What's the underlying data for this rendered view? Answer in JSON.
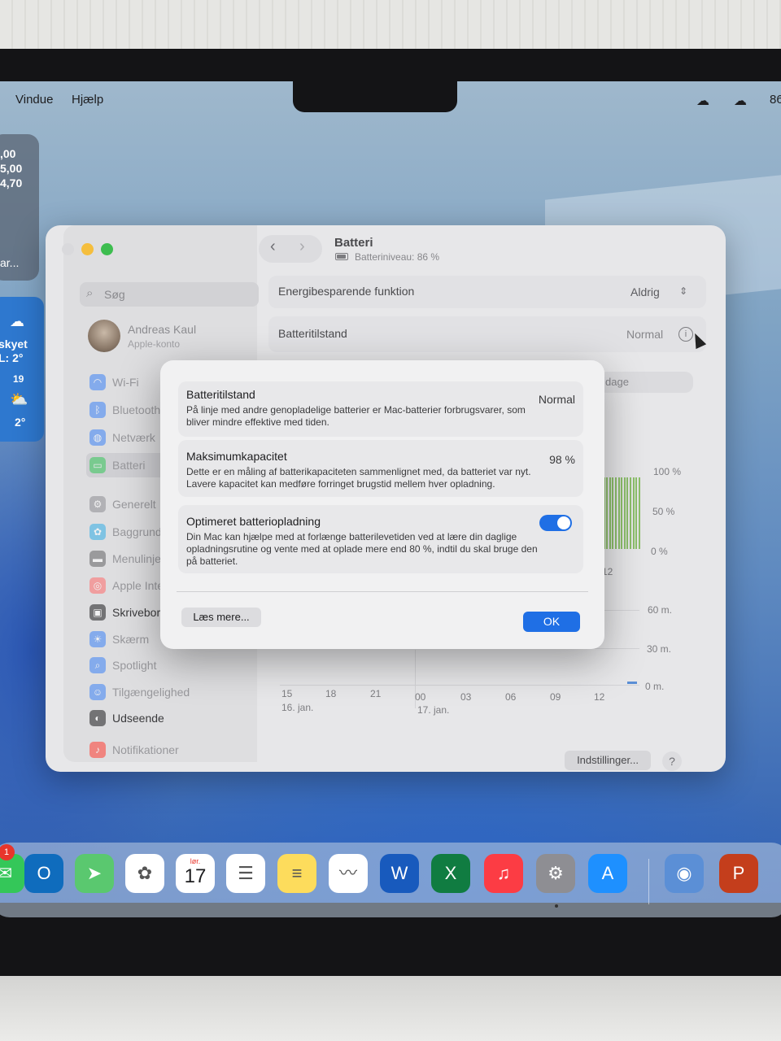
{
  "menubar": {
    "items": [
      "Vindue",
      "Hjælp"
    ],
    "right_text": "86"
  },
  "widgets": {
    "stocks_lines": [
      ",00",
      "5,00",
      "4,70",
      "ar..."
    ],
    "weather": {
      "condition": "skyet",
      "low": "L: 2°",
      "hour": "19",
      "temp": "2°"
    }
  },
  "window": {
    "title": "Batteri",
    "battery_level": "Batteriniveau: 86 %",
    "search_placeholder": "Søg",
    "account": {
      "name": "Andreas Kaul",
      "subtitle": "Apple-konto"
    },
    "sidebar_items": [
      {
        "label": "Wi-Fi",
        "icon": "wifi-icon",
        "color": "#3b82f6"
      },
      {
        "label": "Bluetooth",
        "icon": "bluetooth-icon",
        "color": "#3b82f6"
      },
      {
        "label": "Netværk",
        "icon": "globe-icon",
        "color": "#3b82f6"
      },
      {
        "label": "Batteri",
        "icon": "battery-icon",
        "color": "#34c759",
        "selected": true
      },
      {
        "label": "Generelt",
        "icon": "gear-icon",
        "color": "#8e8e93"
      },
      {
        "label": "Baggrund",
        "icon": "flower-icon",
        "color": "#32ade6"
      },
      {
        "label": "Menulinje",
        "icon": "menubar-icon",
        "color": "#636366"
      },
      {
        "label": "Apple Intellig",
        "icon": "apple-intelligence-icon",
        "color": "#ff6b6b"
      },
      {
        "label": "Skrivebord &",
        "icon": "desktop-icon",
        "color": "#1c1c1e"
      },
      {
        "label": "Skærm",
        "icon": "sun-icon",
        "color": "#3b82f6"
      },
      {
        "label": "Spotlight",
        "icon": "spotlight-icon",
        "color": "#3b82f6"
      },
      {
        "label": "Tilgængelighed",
        "icon": "accessibility-icon",
        "color": "#3b82f6"
      },
      {
        "label": "Udseende",
        "icon": "appearance-icon",
        "color": "#1c1c1e"
      },
      {
        "label": "Notifikationer",
        "icon": "bell-icon",
        "color": "#ff3b30"
      }
    ],
    "rows": {
      "energy_label": "Energibesparende funktion",
      "energy_value": "Aldrig",
      "health_label": "Batteritilstand",
      "health_value": "Normal",
      "partial_tab": "dage"
    },
    "chart": {
      "level_ticks": [
        "100 %",
        "50 %",
        "0 %"
      ],
      "level_xtick": "12",
      "usage_ticks": [
        "60 m.",
        "30 m.",
        "0 m."
      ],
      "time_ticks": [
        "15",
        "18",
        "21",
        "00",
        "03",
        "06",
        "09",
        "12"
      ],
      "date_labels": [
        "16. jan.",
        "17. jan."
      ]
    },
    "settings_button": "Indstillinger...",
    "help_button": "?"
  },
  "chart_data": [
    {
      "type": "bar",
      "y_axis_ticks": [
        "100 %",
        "50 %",
        "0 %"
      ],
      "x_tick": "12",
      "values": [
        100,
        100,
        100,
        100,
        100,
        100,
        100,
        100,
        100,
        100,
        100,
        100,
        100,
        100
      ]
    },
    {
      "type": "bar",
      "y_axis_ticks": [
        "60 m.",
        "30 m.",
        "0 m."
      ],
      "x_ticks": [
        "15",
        "18",
        "21",
        "00",
        "03",
        "06",
        "09",
        "12"
      ],
      "date_labels": [
        "16. jan.",
        "17. jan."
      ],
      "values": [
        0,
        0,
        0,
        0,
        0,
        0,
        0,
        2
      ]
    }
  ],
  "dialog": {
    "health_title": "Batteritilstand",
    "health_value": "Normal",
    "health_desc": "På linje med andre genopladelige batterier er Mac-batterier forbrugsvarer, som bliver mindre effektive med tiden.",
    "capacity_title": "Maksimumkapacitet",
    "capacity_value": "98 %",
    "capacity_desc": "Dette er en måling af batterikapaciteten sammenlignet med, da batteriet var nyt. Lavere kapacitet kan medføre forringet brugstid mellem hver opladning.",
    "optimized_title": "Optimeret batteriopladning",
    "optimized_desc": "Din Mac kan hjælpe med at forlænge batterilevetiden ved at lære din daglige opladningsrutine og vente med at oplade mere end 80 %, indtil du skal bruge den på batteriet.",
    "optimized_enabled": true,
    "learn_more": "Læs mere...",
    "ok": "OK"
  },
  "dock": {
    "badge": "1",
    "calendar": {
      "weekday": "lør.",
      "day": "17"
    },
    "apps": [
      {
        "icon": "messages-icon",
        "color": "#34c759"
      },
      {
        "icon": "outlook-icon",
        "color": "#0f6cbd"
      },
      {
        "icon": "maps-icon",
        "color": "#5ac86f"
      },
      {
        "icon": "photos-icon",
        "color": "#ffffff"
      },
      {
        "icon": "calendar-icon",
        "color": "#ffffff"
      },
      {
        "icon": "reminders-icon",
        "color": "#ffffff"
      },
      {
        "icon": "notes-icon",
        "color": "#fddc5c"
      },
      {
        "icon": "freeform-icon",
        "color": "#ffffff"
      },
      {
        "icon": "word-icon",
        "color": "#185abd"
      },
      {
        "icon": "excel-icon",
        "color": "#107c41"
      },
      {
        "icon": "music-icon",
        "color": "#fc3c44"
      },
      {
        "icon": "system-settings-icon",
        "color": "#8e8e93"
      },
      {
        "icon": "app-store-icon",
        "color": "#1e90ff"
      },
      {
        "icon": "drive-icon",
        "color": "#5b8fd6"
      },
      {
        "icon": "powerpoint-icon",
        "color": "#c43e1c"
      }
    ]
  }
}
